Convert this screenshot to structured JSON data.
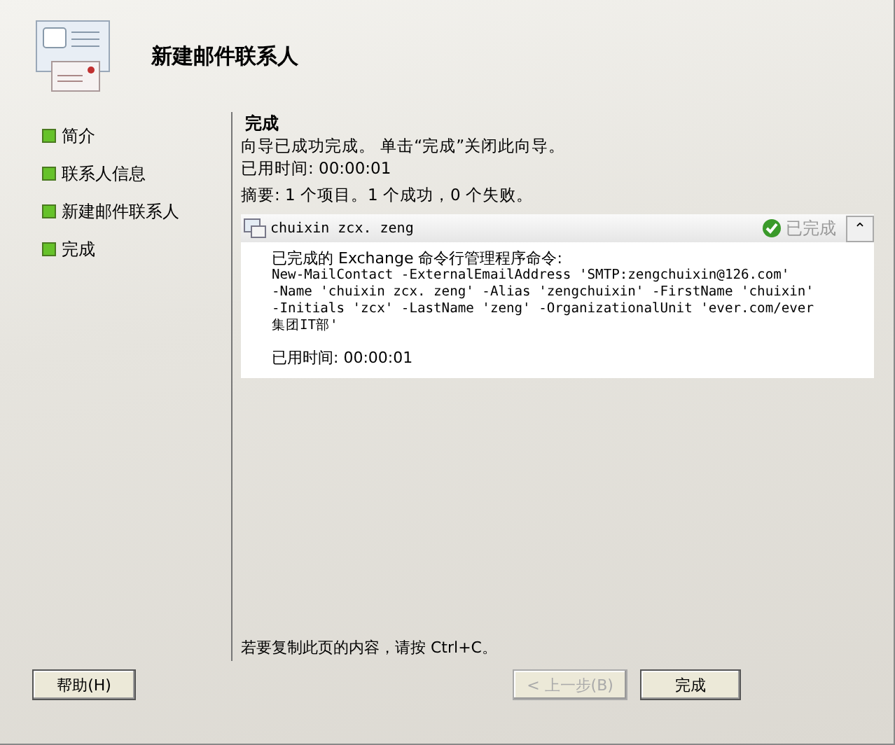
{
  "window": {
    "title": "新建邮件联系人"
  },
  "steps": [
    {
      "label": "简介"
    },
    {
      "label": "联系人信息"
    },
    {
      "label": "新建邮件联系人"
    },
    {
      "label": "完成"
    }
  ],
  "page": {
    "heading": "完成",
    "lines": [
      "向导已成功完成。 单击“完成”关闭此向导。",
      "已用时间: 00:00:01"
    ],
    "summary": "摘要: 1 个项目。1 个成功，0 个失败。"
  },
  "result": {
    "name": "chuixin zcx. zeng",
    "status": "已完成",
    "collapse": "⌃",
    "expanded": true,
    "intro": "已完成的 Exchange 命令行管理程序命令:",
    "command": [
      "New-MailContact -ExternalEmailAddress 'SMTP:zengchuixin@126.com'",
      "-Name 'chuixin zcx. zeng' -Alias 'zengchuixin' -FirstName 'chuixin'",
      "-Initials 'zcx' -LastName 'zeng' -OrganizationalUnit 'ever.com/ever",
      "集团IT部'"
    ],
    "elapsed": "已用时间: 00:00:01"
  },
  "hint": "若要复制此页的内容，请按 Ctrl+C。",
  "buttons": [
    {
      "label": "帮助(H)",
      "disabled": false
    },
    {
      "label": "< 上一步(B)",
      "disabled": true
    },
    {
      "label": "完成",
      "disabled": false
    }
  ]
}
